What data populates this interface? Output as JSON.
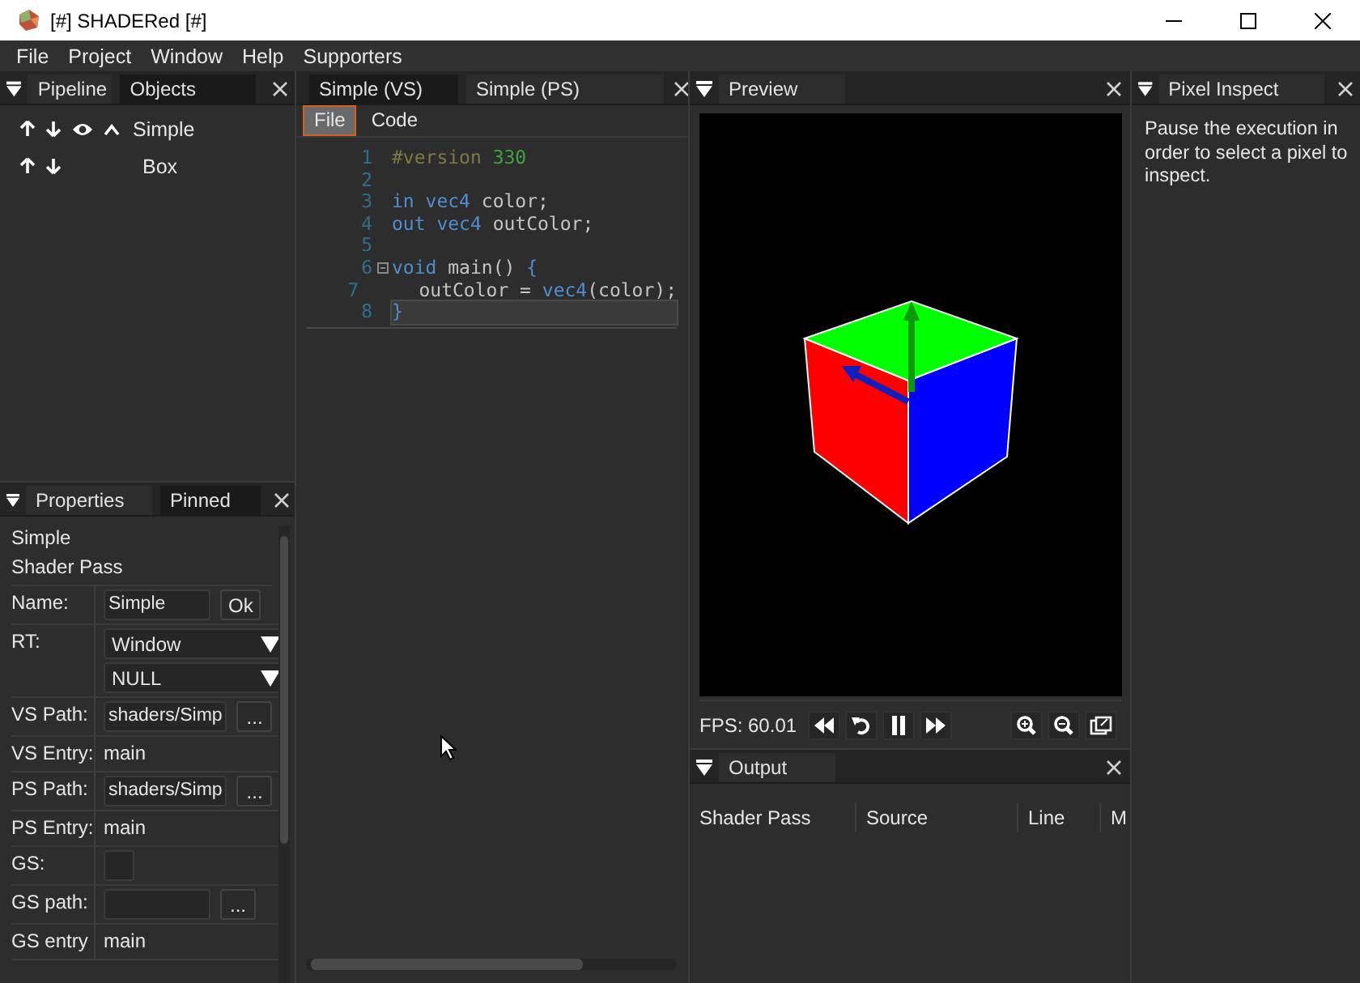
{
  "window": {
    "title": "[#] SHADERed [#]"
  },
  "menu": [
    "File",
    "Project",
    "Window",
    "Help",
    "Supporters"
  ],
  "pipeline_panel": {
    "tabs": [
      {
        "label": "Pipeline",
        "highlighted": false
      },
      {
        "label": "Objects",
        "highlighted": true
      }
    ],
    "items": [
      {
        "kind": "pass",
        "name": "Simple"
      },
      {
        "kind": "object",
        "name": "Box"
      }
    ]
  },
  "properties_panel": {
    "tabs": [
      {
        "label": "Properties",
        "highlighted": false
      },
      {
        "label": "Pinned",
        "highlighted": true
      }
    ],
    "heading": [
      "Simple",
      "Shader Pass"
    ],
    "rows": [
      {
        "kind": "input_button",
        "label": "Name:",
        "value": "Simple",
        "button": "Ok"
      },
      {
        "kind": "dropdowns",
        "label": "RT:",
        "values": [
          "Window",
          "NULL"
        ]
      },
      {
        "kind": "input_button",
        "label": "VS Path:",
        "value": "shaders/Simp",
        "button": "..."
      },
      {
        "kind": "text",
        "label": "VS Entry:",
        "value": "main"
      },
      {
        "kind": "input_button",
        "label": "PS Path:",
        "value": "shaders/Simp",
        "button": "..."
      },
      {
        "kind": "text",
        "label": "PS Entry:",
        "value": "main"
      },
      {
        "kind": "checkbox",
        "label": "GS:",
        "checked": false
      },
      {
        "kind": "input_button",
        "label": "GS path:",
        "button": "..."
      },
      {
        "kind": "text",
        "label": "GS entry",
        "value": "main"
      }
    ]
  },
  "editor_panel": {
    "tabs": [
      {
        "label": "Simple (VS)",
        "highlighted": true
      },
      {
        "label": "Simple (PS)",
        "highlighted": false
      }
    ],
    "subtabs": [
      {
        "label": "File",
        "selected": true
      },
      {
        "label": "Code",
        "selected": false
      }
    ],
    "lines": [
      {
        "number": "1",
        "current": false,
        "foldable": false,
        "tokens": [
          {
            "kind": "preproc",
            "text": "#version "
          },
          {
            "kind": "number",
            "text": "330"
          }
        ]
      },
      {
        "number": "2",
        "current": false,
        "foldable": false
      },
      {
        "number": "3",
        "current": false,
        "foldable": false,
        "tokens": [
          {
            "kind": "keyword",
            "text": "in vec4"
          },
          {
            "kind": "plain",
            "text": " color;"
          }
        ]
      },
      {
        "number": "4",
        "current": false,
        "foldable": false,
        "tokens": [
          {
            "kind": "keyword",
            "text": "out vec4"
          },
          {
            "kind": "plain",
            "text": " outColor;"
          }
        ]
      },
      {
        "number": "5",
        "current": false,
        "foldable": false
      },
      {
        "number": "6",
        "current": false,
        "foldable": true,
        "tokens": [
          {
            "kind": "keyword",
            "text": "void"
          },
          {
            "kind": "plain",
            "text": " main() "
          },
          {
            "kind": "bracket",
            "text": "{"
          }
        ]
      },
      {
        "number": "7",
        "current": false,
        "foldable": false,
        "tokens": [
          {
            "kind": "plain",
            "text": "    outColor = "
          },
          {
            "kind": "keyword",
            "text": "vec4"
          },
          {
            "kind": "plain",
            "text": "(color);"
          }
        ]
      },
      {
        "number": "8",
        "current": true,
        "foldable": false,
        "tokens": [
          {
            "kind": "bracket",
            "text": "}"
          }
        ]
      }
    ]
  },
  "preview_panel": {
    "tabs": [
      {
        "label": "Preview",
        "highlighted": false
      }
    ],
    "fps": "FPS: 60.01"
  },
  "output_panel": {
    "tabs": [
      {
        "label": "Output",
        "highlighted": false
      }
    ],
    "columns": [
      "Shader Pass",
      "Source",
      "Line",
      "M"
    ]
  },
  "inspect_panel": {
    "tabs": [
      {
        "label": "Pixel Inspect",
        "highlighted": false
      }
    ],
    "message": "Pause the execution in order to select a pixel to inspect."
  }
}
